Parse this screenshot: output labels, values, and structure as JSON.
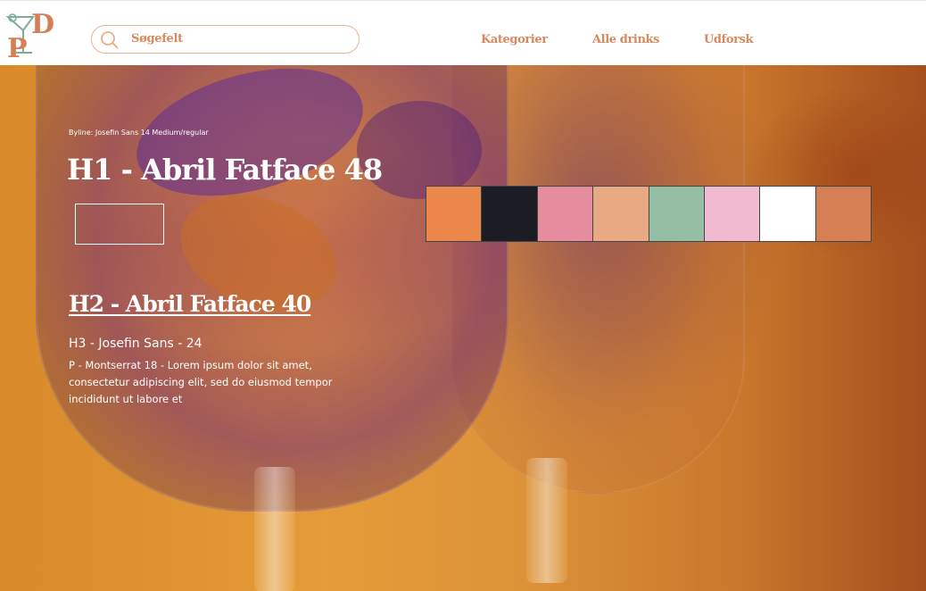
{
  "header": {
    "search": {
      "label": "Søgefelt"
    },
    "nav": [
      {
        "label": "Kategorier"
      },
      {
        "label": "Alle drinks"
      },
      {
        "label": "Udforsk"
      }
    ]
  },
  "hero": {
    "byline": "Byline: Josefin Sans 14 Medium/regular",
    "h1": "H1 -  Abril Fatface 48",
    "h2": "H2 - Abril Fatface 40",
    "h3": "H3 - Josefin Sans - 24",
    "paragraph": "P - Montserrat 18 - Lorem ipsum dolor sit amet, consectetur adipiscing elit, sed do eiusmod tempor incididunt ut labore et"
  },
  "palette": [
    "#ec874c",
    "#1c1d24",
    "#e58c9e",
    "#e9aa83",
    "#96bea5",
    "#f2bad0",
    "#ffffff",
    "#d57f55"
  ],
  "colors": {
    "accent": "#d68a5d",
    "logo_green": "#7fae98",
    "logo_orange": "#d57f55"
  }
}
